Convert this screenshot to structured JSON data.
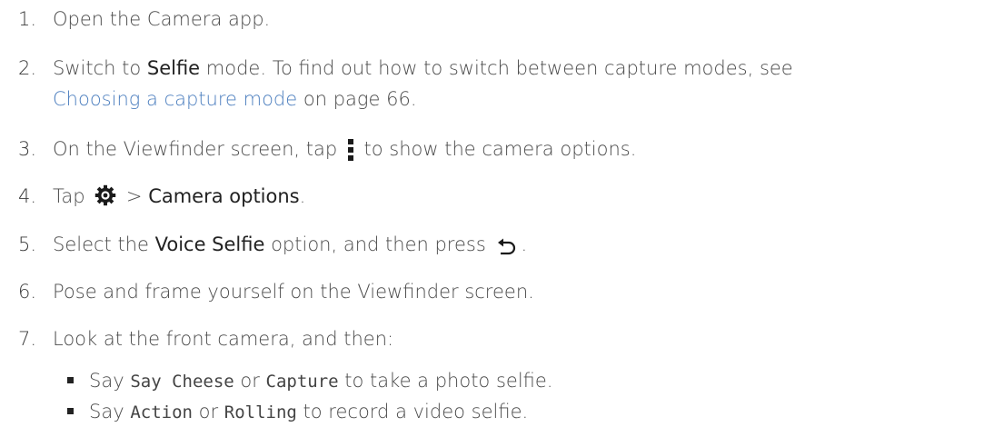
{
  "steps": [
    {
      "num": "1.",
      "text": "Open the Camera app."
    },
    {
      "num": "2.",
      "pre": "Switch to ",
      "bold": "Selfie",
      "post": " mode. To find out how to switch between capture modes, see",
      "link": "Choosing a capture mode",
      "post2": " on page 66."
    },
    {
      "num": "3.",
      "pre": "On the Viewfinder screen, tap ",
      "post": " to show the camera options."
    },
    {
      "num": "4.",
      "pre": "Tap ",
      "mid": " > ",
      "bold": "Camera options",
      "post": "."
    },
    {
      "num": "5.",
      "pre": "Select the ",
      "bold": "Voice Selfie",
      "post": " option, and then press ",
      "end": "."
    },
    {
      "num": "6.",
      "text": "Pose and frame yourself on the Viewfinder screen."
    },
    {
      "num": "7.",
      "text": "Look at the front camera, and then:"
    }
  ],
  "bullets": [
    {
      "pre": "Say ",
      "code1": "Say Cheese",
      "mid": " or ",
      "code2": "Capture",
      "post": " to take a photo selfie."
    },
    {
      "pre": "Say ",
      "code1": "Action",
      "mid": " or ",
      "code2": "Rolling",
      "post": " to record a video selfie."
    }
  ],
  "icons": {
    "step3": "more-options-icon",
    "step4": "settings-gear-icon",
    "step5": "back-icon"
  }
}
